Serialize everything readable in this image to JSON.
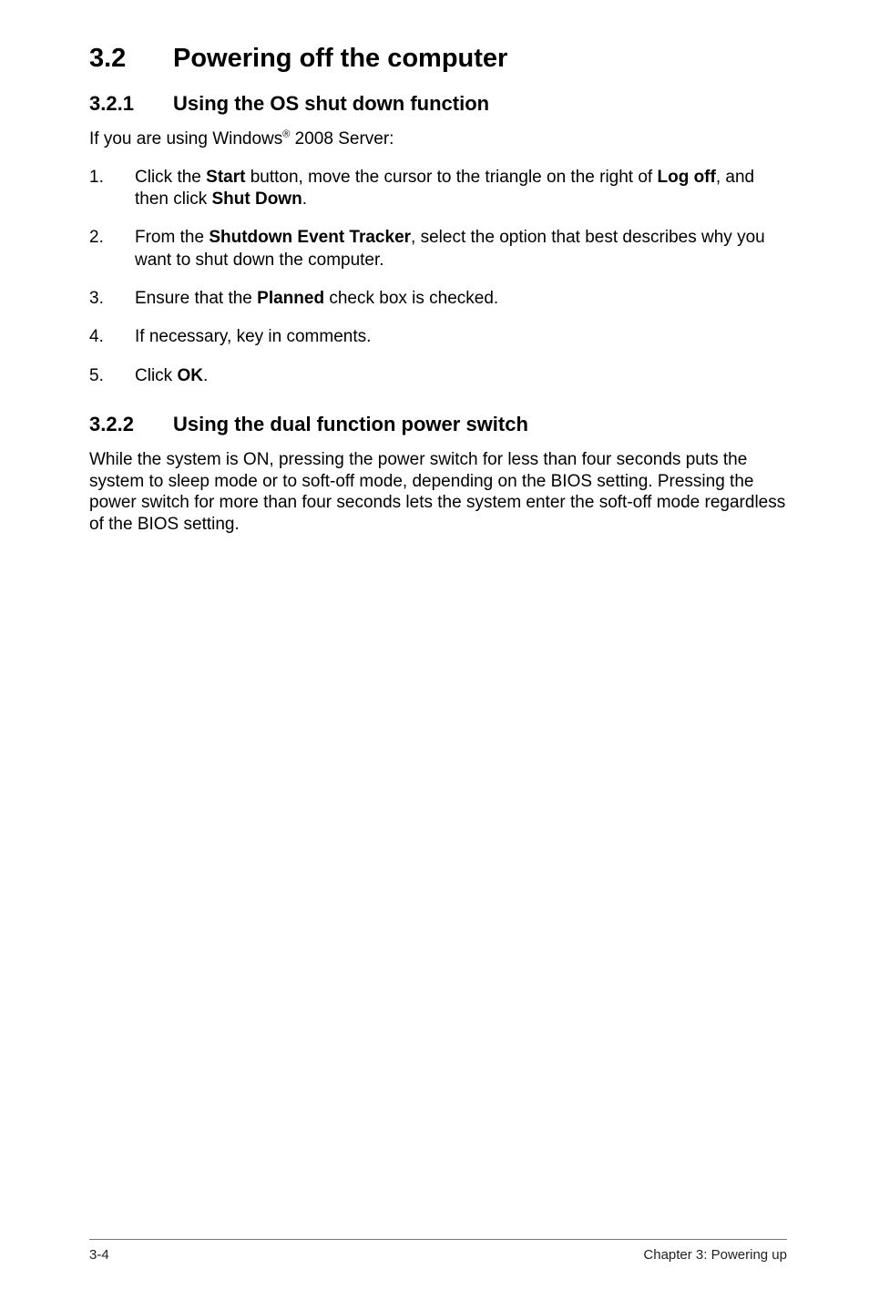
{
  "section": {
    "number": "3.2",
    "title": "Powering off the computer"
  },
  "sub1": {
    "number": "3.2.1",
    "title": "Using the OS shut down function",
    "intro_prefix": "If you are using Windows",
    "intro_sup": "®",
    "intro_suffix": " 2008 Server:",
    "steps": [
      {
        "marker": "1.",
        "parts": [
          {
            "t": "Click the "
          },
          {
            "t": "Start",
            "b": true
          },
          {
            "t": " button, move the cursor to the triangle on the right of "
          },
          {
            "t": "Log off",
            "b": true
          },
          {
            "t": ", and then click "
          },
          {
            "t": "Shut Down",
            "b": true
          },
          {
            "t": "."
          }
        ]
      },
      {
        "marker": "2.",
        "parts": [
          {
            "t": "From the "
          },
          {
            "t": "Shutdown Event Tracker",
            "b": true
          },
          {
            "t": ", select the option that best describes why you want to shut down the computer."
          }
        ]
      },
      {
        "marker": "3.",
        "parts": [
          {
            "t": "Ensure that the "
          },
          {
            "t": "Planned",
            "b": true
          },
          {
            "t": " check box is checked."
          }
        ]
      },
      {
        "marker": "4.",
        "parts": [
          {
            "t": "If necessary, key in comments."
          }
        ]
      },
      {
        "marker": "5.",
        "parts": [
          {
            "t": "Click "
          },
          {
            "t": "OK",
            "b": true
          },
          {
            "t": "."
          }
        ]
      }
    ]
  },
  "sub2": {
    "number": "3.2.2",
    "title": "Using the dual function power switch",
    "para": "While the system is ON, pressing the power switch for less than four seconds puts the system to sleep mode or to soft-off mode, depending on the BIOS setting. Pressing the power switch for more than four seconds lets the system enter the soft-off mode regardless of the BIOS setting."
  },
  "footer": {
    "left": "3-4",
    "right": "Chapter 3: Powering up"
  }
}
